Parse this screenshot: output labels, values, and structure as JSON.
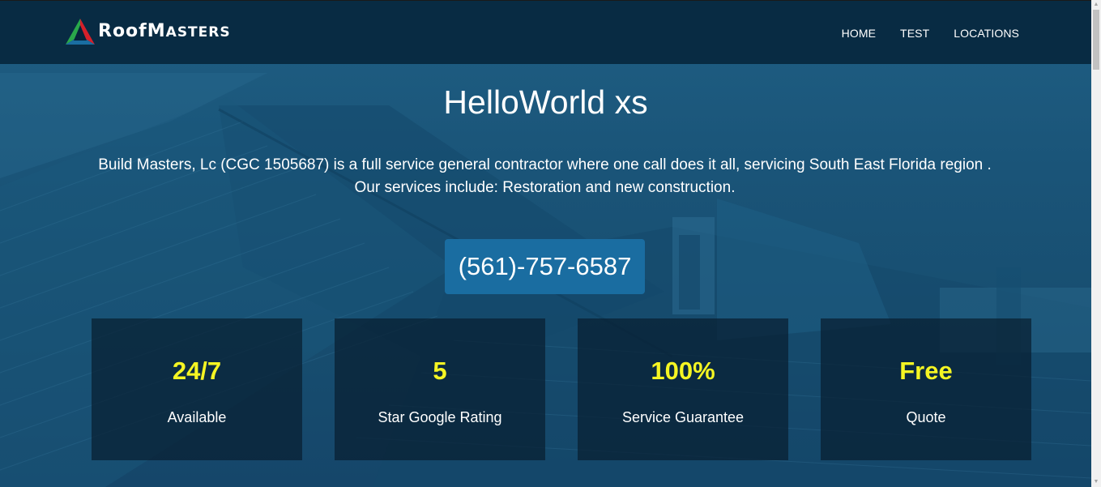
{
  "brand": {
    "name_first": "Roof",
    "name_second_cap": "M",
    "name_second_rest": "ASTERS",
    "colors": {
      "green": "#2aa84a",
      "red": "#d6202a",
      "blue": "#1a6da1"
    }
  },
  "nav": {
    "items": [
      {
        "label": "HOME"
      },
      {
        "label": "TEST"
      },
      {
        "label": "LOCATIONS"
      }
    ]
  },
  "hero": {
    "title": "HelloWorld xs",
    "description_line1": "Build Masters, Lc (CGC 1505687) is a full service general contractor where one call does it all, servicing South East Florida region .",
    "description_line2": "Our services include: Restoration and new construction.",
    "phone": "(561)-757-6587"
  },
  "stats": [
    {
      "value": "24/7",
      "label": "Available"
    },
    {
      "value": "5",
      "label": "Star Google Rating"
    },
    {
      "value": "100%",
      "label": "Service Guarantee"
    },
    {
      "value": "Free",
      "label": "Quote"
    }
  ],
  "colors": {
    "header_bg": "#06243a",
    "accent_yellow": "#f5f523",
    "button_blue": "#1a6da1"
  },
  "icons": {
    "logo": "triangle-logo-icon",
    "scroll_up": "arrow-up-icon",
    "scroll_down": "arrow-down-icon"
  }
}
